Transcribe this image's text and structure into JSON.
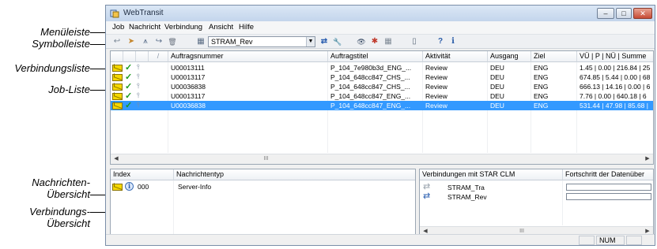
{
  "callouts": {
    "menubar": "Menüleiste",
    "toolbar": "Symbolleiste",
    "connection_list": "Verbindungsliste",
    "job_list": "Job-Liste",
    "message_overview_line1": "Nachrichten-",
    "message_overview_line2": "Übersicht",
    "connection_overview_line1": "Verbindungs-",
    "connection_overview_line2": "Übersicht"
  },
  "window": {
    "title": "WebTransit",
    "minimize": "–",
    "maximize": "□",
    "close": "✕"
  },
  "menu": [
    "Job",
    "Nachricht",
    "Verbindung",
    "Ansicht",
    "Hilfe"
  ],
  "toolbar": {
    "selected_connection": "STRAM_Rev",
    "dropdown_glyph": "▼"
  },
  "icons": {
    "send_back": "↩",
    "arrow": "➤",
    "tray": "⩚",
    "inbox": "↪",
    "trash": "🗑",
    "connection": "⇄",
    "wrench": "🔧",
    "eye": "👁",
    "eye_cross": "✱",
    "grid": "▦",
    "doc": "▯",
    "help": "?",
    "info": "i",
    "check": "✓",
    "clip": "⫯",
    "scroll_left": "◀",
    "scroll_right": "▶",
    "thumb": "III"
  },
  "jobs": {
    "header_slash": "/",
    "columns": [
      "Auftragsnummer",
      "Auftragstitel",
      "Aktivität",
      "Ausgang",
      "Ziel",
      "VÜ | P | NÜ | Summe"
    ],
    "rows": [
      {
        "number": "U00013111",
        "title": "P_104_7e980b3d_ENG_...",
        "activity": "Review",
        "source": "DEU",
        "target": "ENG",
        "sum": "1.45 | 0.00 | 216.84 | 25",
        "selected": false
      },
      {
        "number": "U00013117",
        "title": "P_104_648cc847_CHS_...",
        "activity": "Review",
        "source": "DEU",
        "target": "ENG",
        "sum": "674.85 | 5.44 | 0.00 | 68",
        "selected": false
      },
      {
        "number": "U00036838",
        "title": "P_104_648cc847_CHS_...",
        "activity": "Review",
        "source": "DEU",
        "target": "ENG",
        "sum": "666.13 | 14.16 | 0.00 | 6",
        "selected": false
      },
      {
        "number": "U00013117",
        "title": "P_104_648cc847_ENG_...",
        "activity": "Review",
        "source": "DEU",
        "target": "ENG",
        "sum": "7.76 | 0.00 | 640.18 | 6",
        "selected": false
      },
      {
        "number": "U00036838",
        "title": "P_104_648cc847_ENG_...",
        "activity": "Review",
        "source": "DEU",
        "target": "ENG",
        "sum": "531.44 | 47.98 | 85.68 |",
        "selected": true
      }
    ]
  },
  "messages": {
    "columns": [
      "Index",
      "Nachrichtentyp"
    ],
    "rows": [
      {
        "index": "000",
        "type": "Server-Info"
      }
    ]
  },
  "connections": {
    "columns": [
      "Verbindungen mit STAR CLM",
      "Fortschritt der Datenüber"
    ],
    "rows": [
      {
        "name": "STRAM_Tra",
        "active": false
      },
      {
        "name": "STRAM_Rev",
        "active": true
      }
    ]
  },
  "status": {
    "num": "NUM"
  },
  "colors": {
    "selection": "#3399ff",
    "check": "#1c9a1c",
    "envelope": "#f5d800",
    "connection_active": "#2b5fb0",
    "connection_inactive": "#9aa3ad"
  }
}
